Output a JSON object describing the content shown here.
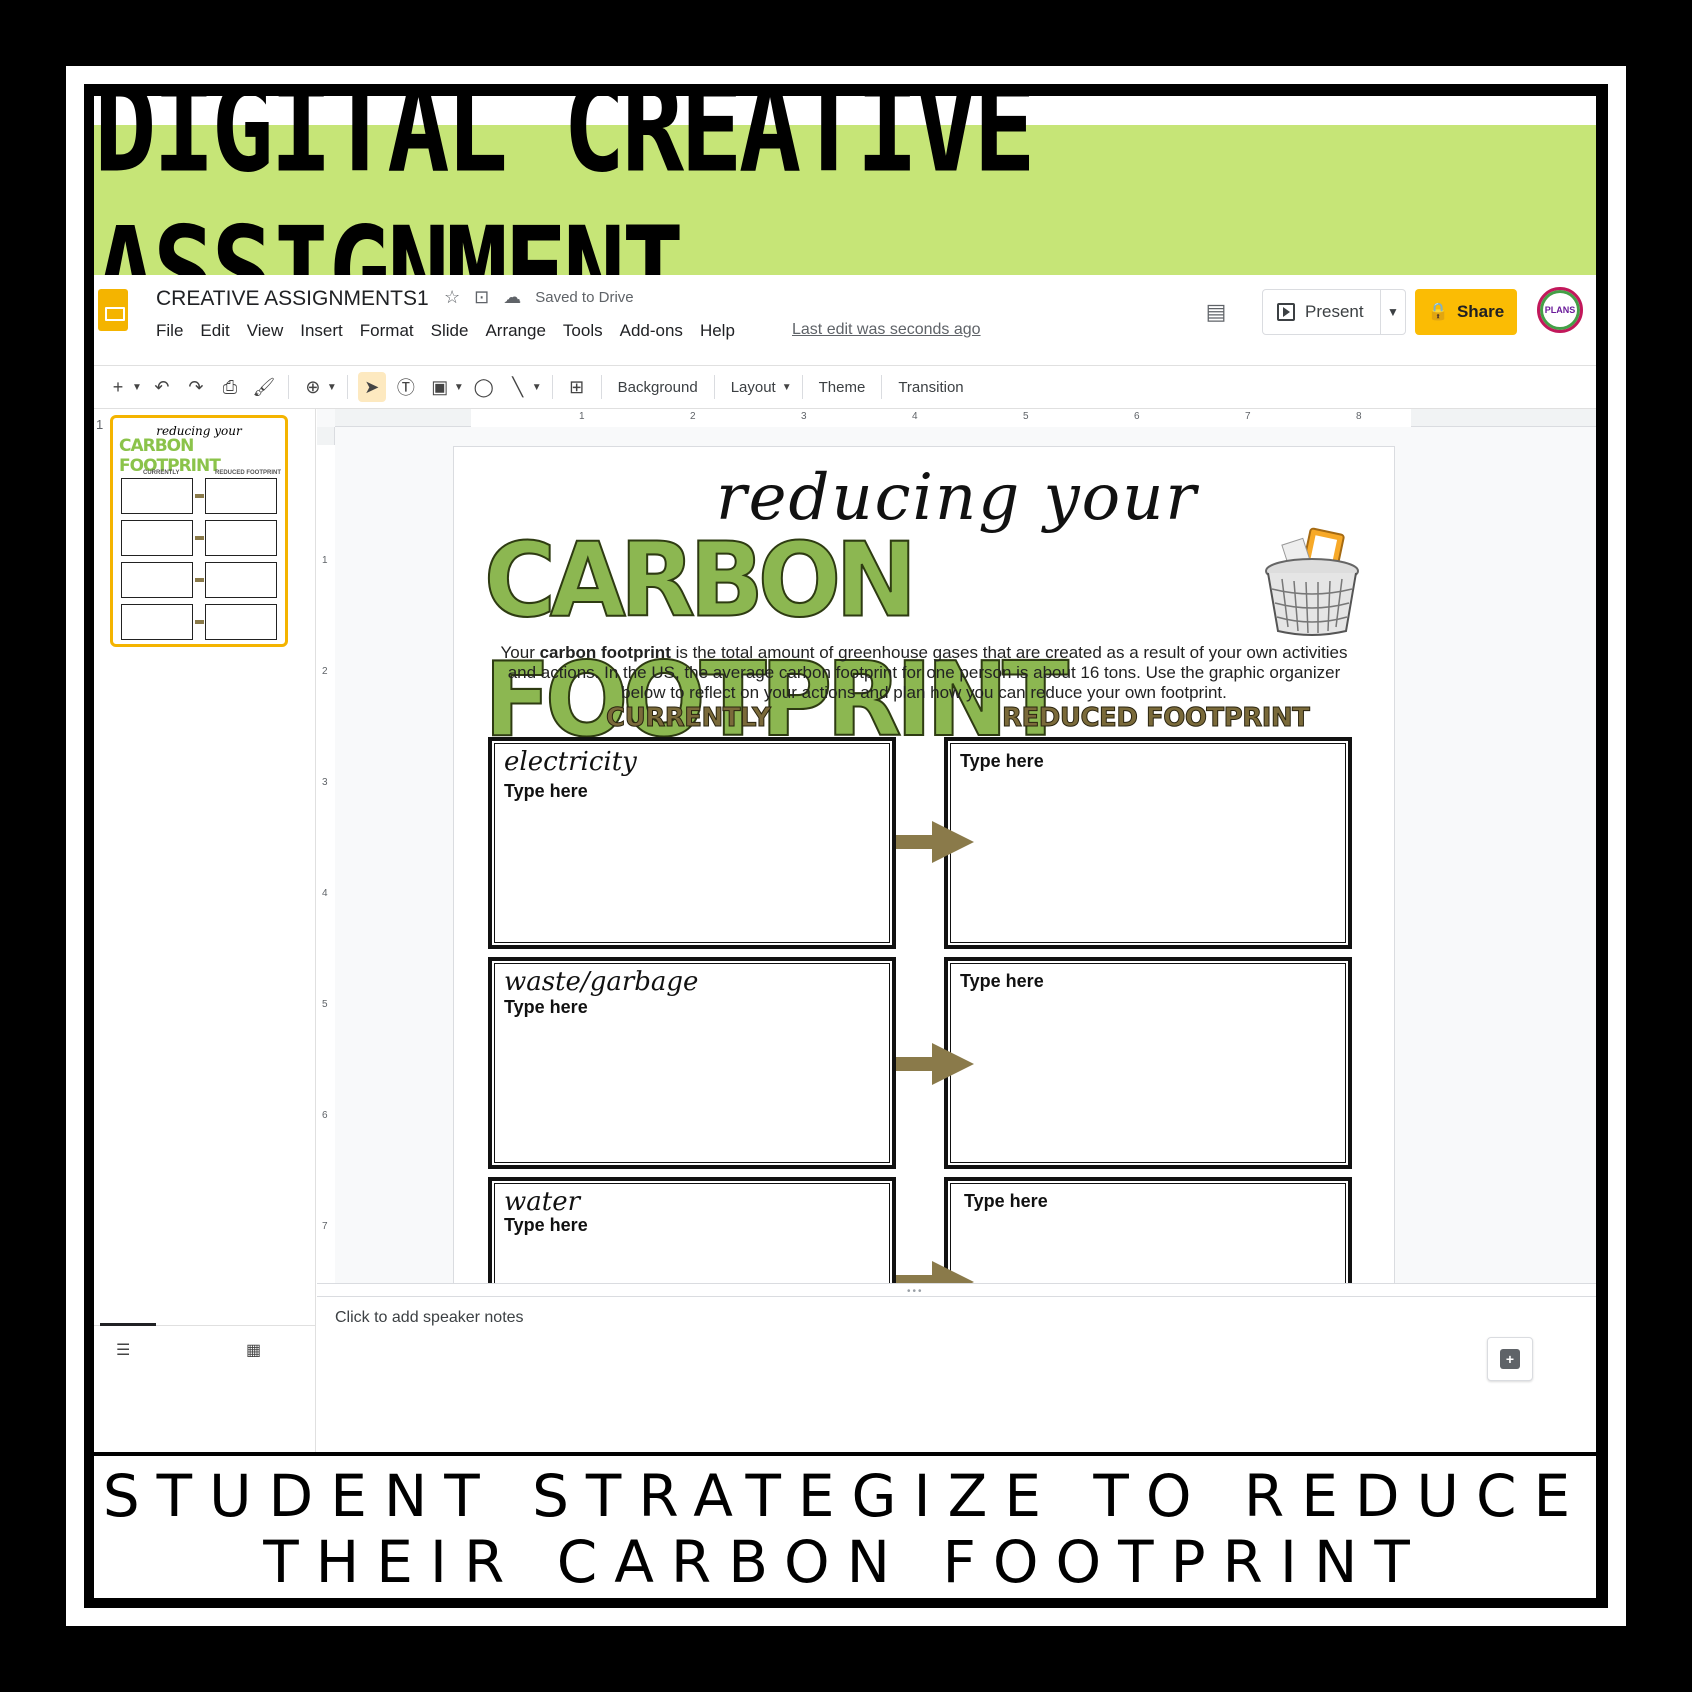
{
  "banner": {
    "title": "DIGITAL CREATIVE ASSIGNMENT"
  },
  "caption": {
    "line1": "STUDENT STRATEGIZE TO REDUCE",
    "line2": "THEIR CARBON FOOTPRINT"
  },
  "app": {
    "doc_title": "CREATIVE ASSIGNMENTS1",
    "saved_status": "Saved to Drive",
    "menu": [
      "File",
      "Edit",
      "View",
      "Insert",
      "Format",
      "Slide",
      "Arrange",
      "Tools",
      "Add-ons",
      "Help"
    ],
    "last_edit": "Last edit was seconds ago",
    "present_label": "Present",
    "share_label": "Share",
    "avatar_text": "PLANS",
    "toolbar": {
      "background": "Background",
      "layout": "Layout",
      "theme": "Theme",
      "transition": "Transition"
    },
    "slide_number": "1",
    "notes_placeholder": "Click to add speaker notes",
    "ruler_h": [
      "1",
      "2",
      "3",
      "4",
      "5",
      "6",
      "7",
      "8"
    ],
    "ruler_v": [
      "1",
      "2",
      "3",
      "4",
      "5",
      "6",
      "7"
    ]
  },
  "slide": {
    "title_script": "reducing your",
    "title_main": "CARBON FOOTPRINT",
    "desc_pre": "Your ",
    "desc_bold": "carbon footprint",
    "desc_post": " is the total amount of greenhouse gases that are created as a result of your own activities and actions. In the US, the average carbon footprint for one person is about 16 tons.  Use the graphic organizer below to reflect on your actions and plan how you can reduce your own footprint.",
    "col_currently": "CURRENTLY",
    "col_reduced": "REDUCED FOOTPRINT",
    "rows": [
      {
        "label": "electricity",
        "current": "Type here",
        "reduced": "Type here"
      },
      {
        "label": "waste/garbage",
        "current": "Type here",
        "reduced": "Type here"
      },
      {
        "label": "water",
        "current": "Type here",
        "reduced": "Type here"
      }
    ]
  },
  "colors": {
    "banner_green": "#c6e577",
    "title_green": "#8cb751",
    "arrow_brown": "#8a7a4a",
    "share_yellow": "#fbbc04",
    "thumb_border": "#f4b400"
  }
}
